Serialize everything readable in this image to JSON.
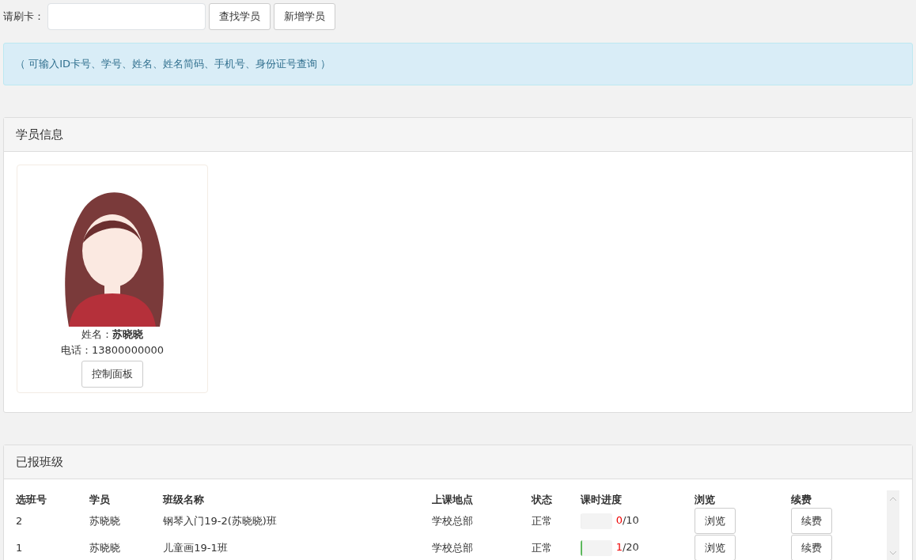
{
  "search": {
    "label": "请刷卡："
  },
  "buttons": [
    "查找学员",
    "新增学员"
  ],
  "hint": "（ 可输入ID卡号、学号、姓名、姓名简码、手机号、身份证号查询 ）",
  "student_panel": {
    "title": "学员信息",
    "name": "姓名：**苏晓晓**",
    "phone": "电话：13800000000",
    "button": "控制面板"
  },
  "classes_panel": {
    "title": "已报班级",
    "columns": [
      "选班号",
      "学员",
      "班级名称",
      "上课地点",
      "状态",
      "课时进度",
      "浏览",
      "续费"
    ],
    "rows": [
      {
        "id": "2",
        "student": "苏晓晓",
        "class_name": "钢琴入门19-2(苏晓晓)班",
        "location": "学校总部",
        "status": "正常",
        "level": 0,
        "done": "0",
        "total": "/10",
        "browse": "浏览",
        "renew": "续费"
      },
      {
        "id": "1",
        "student": "苏晓晓",
        "class_name": "儿童画19-1班",
        "location": "学校总部",
        "status": "正常",
        "level": 0.05,
        "done": "1",
        "total": "/20",
        "browse": "浏览",
        "renew": "续费"
      }
    ]
  }
}
